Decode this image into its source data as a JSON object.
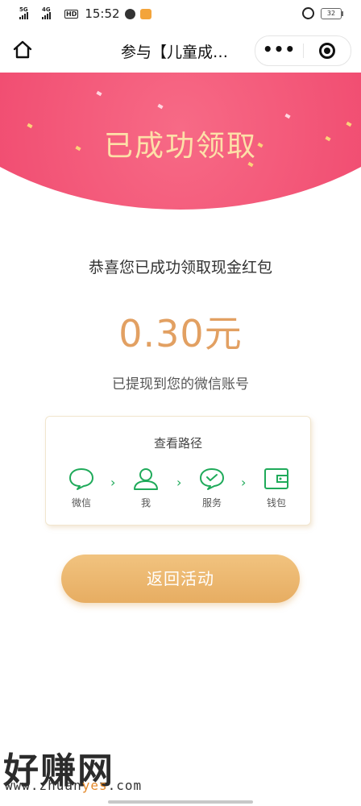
{
  "status_bar": {
    "signal1_label": "5G",
    "signal2_label": "4G",
    "hd_label": "HD",
    "time": "15:52",
    "battery": "32"
  },
  "nav": {
    "title": "参与【儿童成…",
    "more_label": "•••"
  },
  "hero": {
    "title": "已成功领取",
    "colors": {
      "banner": "#f14e72",
      "title": "#fde0a8"
    }
  },
  "main": {
    "congrats_text": "恭喜您已成功领取现金红包",
    "amount": "0.30元",
    "withdrawn_text": "已提现到您的微信账号",
    "colors": {
      "amount": "#e2a062"
    }
  },
  "path": {
    "title": "查看路径",
    "steps": [
      {
        "label": "微信",
        "icon": "chat-bubble-icon"
      },
      {
        "label": "我",
        "icon": "user-icon"
      },
      {
        "label": "服务",
        "icon": "check-bubble-icon"
      },
      {
        "label": "钱包",
        "icon": "wallet-icon"
      }
    ],
    "separator": "›",
    "colors": {
      "icon": "#1faa5a"
    }
  },
  "return_button": {
    "label": "返回活动",
    "color": "#e7ad62"
  },
  "watermark": {
    "logo": "好赚网",
    "url_prefix": "www.zhuan",
    "url_highlight": "yes",
    "url_suffix": ".com"
  }
}
